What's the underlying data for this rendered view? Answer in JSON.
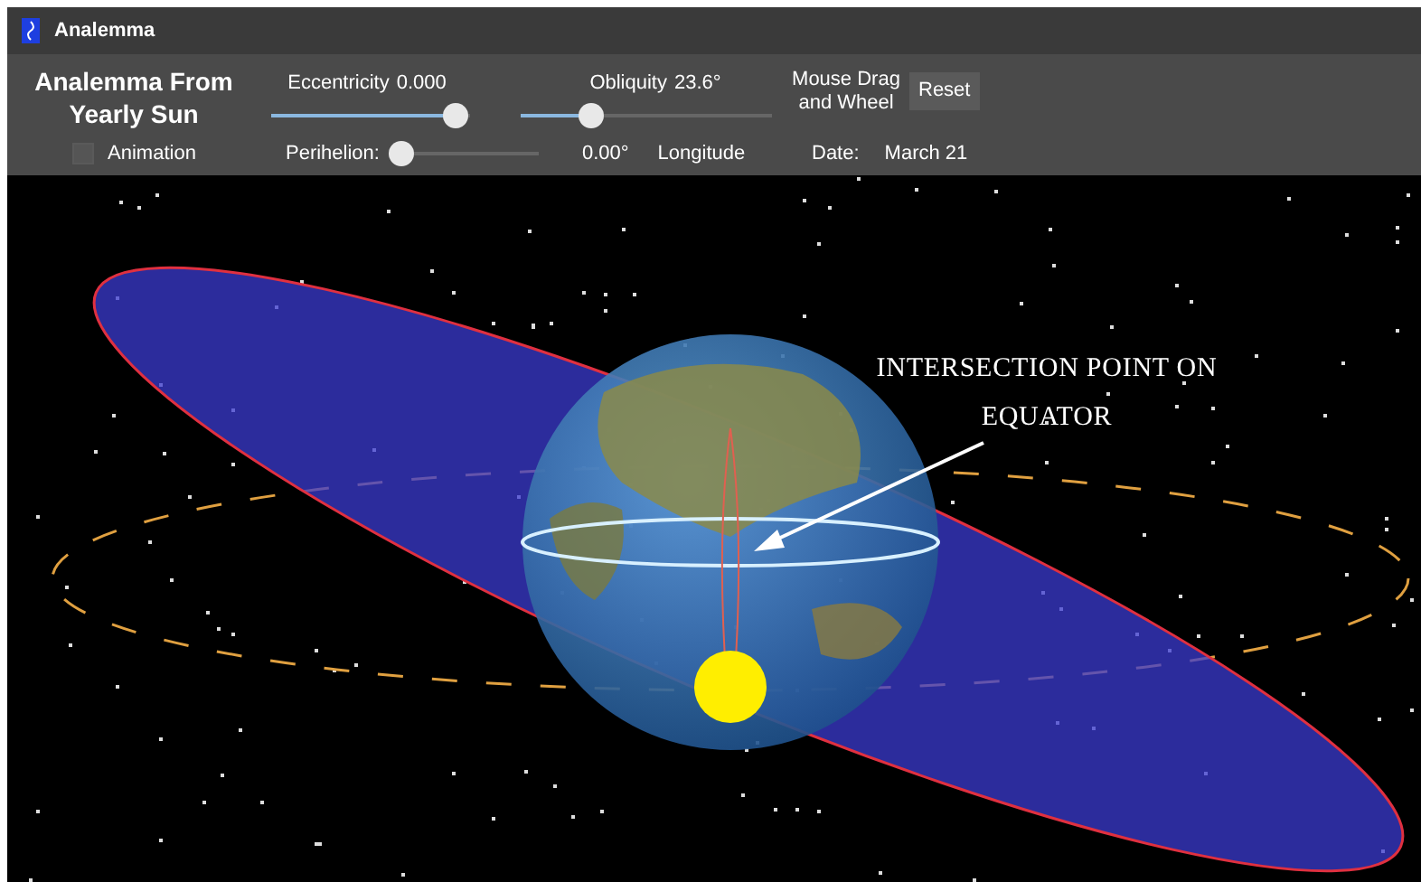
{
  "window": {
    "title": "Analemma"
  },
  "toolbar": {
    "title": "Analemma From Yearly Sun",
    "animation": {
      "label": "Animation",
      "checked": false
    },
    "eccentricity": {
      "label": "Eccentricity",
      "reading": "0.000",
      "level": 0.93
    },
    "obliquity": {
      "label": "Obliquity",
      "reading": "23.6°",
      "level": 0.28
    },
    "perihelion": {
      "label": "Perihelion:",
      "reading": "0.00°",
      "unit": "Longitude",
      "level": 0.05
    },
    "hint": "Mouse Drag and Wheel",
    "reset": "Reset",
    "date": {
      "label": "Date:",
      "value": "March 21"
    }
  },
  "scene": {
    "annotation": "INTERSECTION POINT ON EQUATOR"
  }
}
